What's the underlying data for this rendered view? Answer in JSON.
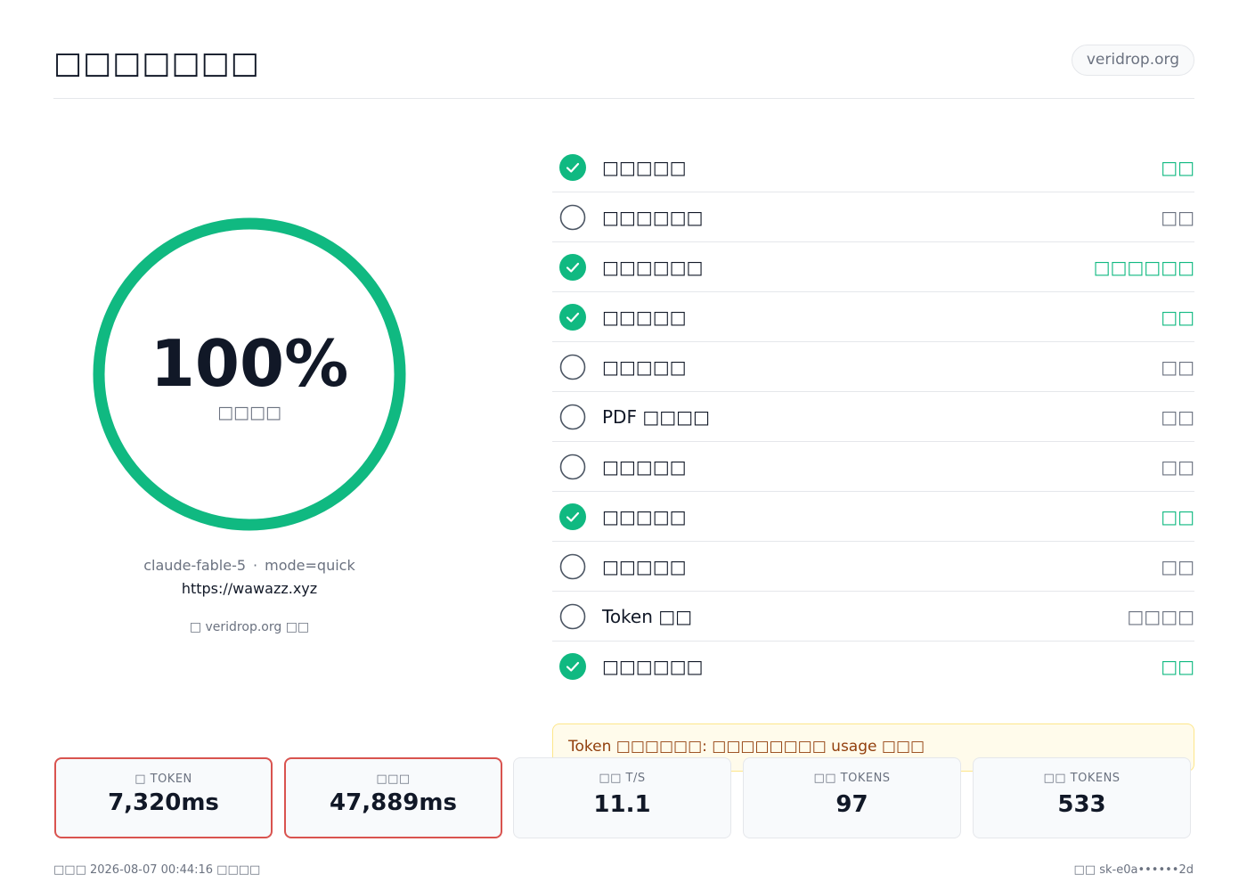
{
  "header": {
    "title": "□□□□□□□",
    "domain_pill": "veridrop.org"
  },
  "score": {
    "value": "100%",
    "fraction": 1.0,
    "caption": "□□□□",
    "ring_color": "#10b981"
  },
  "meta": {
    "model": "claude-fable-5",
    "separator": "·",
    "mode": "mode=quick",
    "url": "https://wawazz.xyz",
    "by": "□ veridrop.org □□"
  },
  "checks": [
    {
      "label": "□□□□□",
      "status": "□□",
      "passed": true
    },
    {
      "label": "□□□□□□",
      "status": "□□",
      "passed": false
    },
    {
      "label": "□□□□□□",
      "status": "□□□□□□",
      "passed": true
    },
    {
      "label": "□□□□□",
      "status": "□□",
      "passed": true
    },
    {
      "label": "□□□□□",
      "status": "□□",
      "passed": false
    },
    {
      "label": "PDF □□□□",
      "status": "□□",
      "passed": false
    },
    {
      "label": "□□□□□",
      "status": "□□",
      "passed": false
    },
    {
      "label": "□□□□□",
      "status": "□□",
      "passed": true
    },
    {
      "label": "□□□□□",
      "status": "□□",
      "passed": false
    },
    {
      "label": "Token □□",
      "status": "□□□□",
      "passed": false
    },
    {
      "label": "□□□□□□",
      "status": "□□",
      "passed": true
    }
  ],
  "notice": "Token □□□□□□: □□□□□□□□ usage □□□",
  "stats": [
    {
      "label": "□ TOKEN",
      "value": "7,320ms",
      "alert": true
    },
    {
      "label": "□□□",
      "value": "47,889ms",
      "alert": true
    },
    {
      "label": "□□ T/S",
      "value": "11.1",
      "alert": false
    },
    {
      "label": "□□ TOKENS",
      "value": "97",
      "alert": false
    },
    {
      "label": "□□ TOKENS",
      "value": "533",
      "alert": false
    }
  ],
  "footer": {
    "left": "□□□ 2026-08-07 00:44:16 □□□□",
    "right": "□□ sk-e0a••••••2d"
  },
  "colors": {
    "success": "#10b981",
    "alert_border": "#d9534f",
    "neutral_icon": "#4b5563"
  }
}
